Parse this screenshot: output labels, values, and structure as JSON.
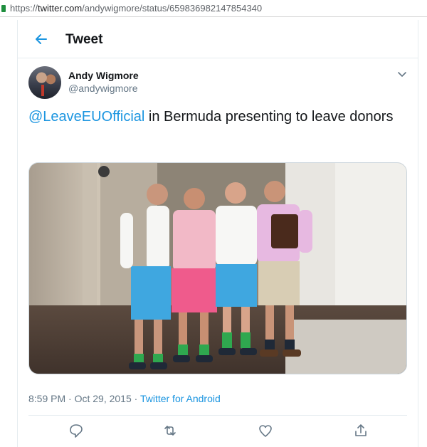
{
  "browser": {
    "url_scheme": "https://",
    "url_host": "twitter.com",
    "url_path": "/andywigmore/status/659836982147854340"
  },
  "header": {
    "title": "Tweet"
  },
  "tweet": {
    "author_name": "Andy Wigmore",
    "author_handle": "@andywigmore",
    "mention": "@LeaveEUOfficial",
    "text_rest": " in Bermuda presenting to leave donors",
    "timestamp": "8:59 PM · Oct 29, 2015 · ",
    "source": "Twitter for Android"
  },
  "actions": {
    "icons": [
      "reply-icon",
      "retweet-icon",
      "like-icon",
      "share-icon"
    ]
  },
  "colors": {
    "accent": "#1b95e0",
    "secondary_text": "#657786",
    "divider": "#e6ecf0"
  }
}
